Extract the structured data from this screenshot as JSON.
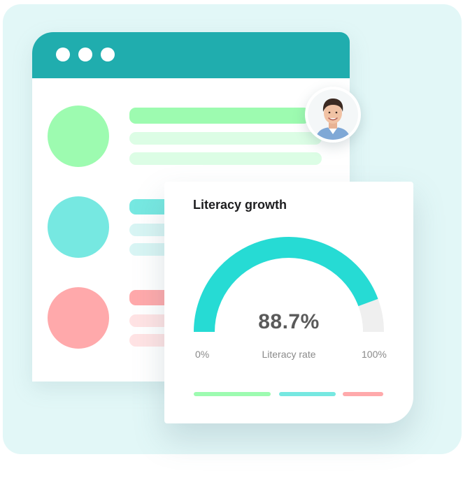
{
  "colors": {
    "background_panel": "#e2f7f7",
    "titlebar": "#20adae",
    "green": "#9dfbb0",
    "green_light": "#dcfde5",
    "teal": "#76e8e1",
    "teal_light": "#d8f5f4",
    "red": "#ffa9ab",
    "red_light": "#ffe3e4",
    "gauge_fill": "#26dbd4",
    "gauge_track": "#efefef"
  },
  "window": {
    "controls": [
      "window-dot-icon",
      "window-dot-icon",
      "window-dot-icon"
    ],
    "rows": [
      {
        "accent": "green"
      },
      {
        "accent": "teal"
      },
      {
        "accent": "red"
      }
    ]
  },
  "avatar": {
    "icon": "user-avatar-icon"
  },
  "card": {
    "title": "Literacy growth",
    "gauge": {
      "value": 88.7,
      "value_text": "88.7%",
      "label": "Literacy rate",
      "min_label": "0%",
      "max_label": "100%",
      "min": 0,
      "max": 100
    },
    "legend": [
      "green",
      "teal",
      "red"
    ]
  }
}
